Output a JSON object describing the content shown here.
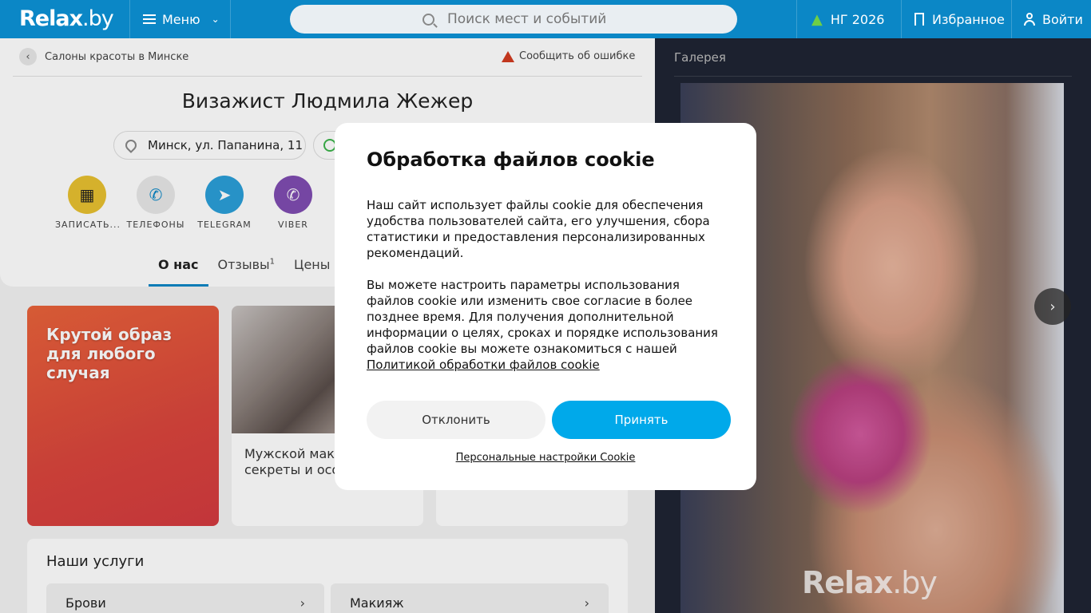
{
  "header": {
    "logo_main": "Relax",
    "logo_suffix": ".by",
    "menu_label": "Меню",
    "search_placeholder": "Поиск мест и событий",
    "ng_label": "НГ 2026",
    "favorites_label": "Избранное",
    "login_label": "Войти"
  },
  "page": {
    "breadcrumb": "Салоны красоты в Минске",
    "report_error": "Сообщить об ошибке",
    "title": "Визажист Людмила Жежер",
    "address": "Минск, ул. Папанина, 11",
    "actions": [
      {
        "label": "ЗАПИСАТЬ...",
        "color": "#e8c030"
      },
      {
        "label": "ТЕЛЕФОНЫ",
        "color": "#e8e8e8"
      },
      {
        "label": "TELEGRAM",
        "color": "#2b9fd8"
      },
      {
        "label": "VIBER",
        "color": "#7f4db1"
      }
    ],
    "tabs": [
      {
        "label": "О нас"
      },
      {
        "label": "Отзывы",
        "count": "1"
      },
      {
        "label": "Цены"
      }
    ],
    "promo_text": "Крутой образ для любого случая",
    "article_text": "Мужской макияж: секреты и особенности",
    "services_title": "Наши услуги",
    "services": [
      "Брови",
      "Макияж"
    ]
  },
  "gallery": {
    "title": "Галерея",
    "watermark_main": "Relax",
    "watermark_suffix": ".by"
  },
  "cookie_modal": {
    "title": "Обработка файлов cookie",
    "paragraph1": "Наш сайт использует файлы cookie для обеспечения удобства пользователей сайта, его улучшения, сбора статистики и предоставления персонализированных рекомендаций.",
    "paragraph2": "Вы можете настроить параметры использования файлов cookie или изменить свое согласие в более позднее время. Для получения дополнительной информации о целях, сроках и порядке использования файлов cookie вы можете ознакомиться с нашей",
    "policy_link": "Политикой обработки файлов cookie",
    "decline_label": "Отклонить",
    "accept_label": "Принять",
    "personal_settings": "Персональные настройки Cookie"
  },
  "colors": {
    "brand_header": "#0b87c6",
    "accept_button": "#00a9ea"
  }
}
